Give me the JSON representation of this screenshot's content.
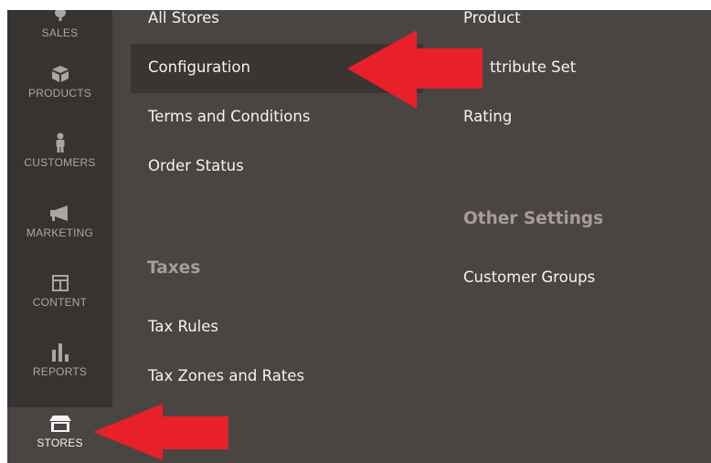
{
  "sidebar": {
    "items": [
      {
        "label": "SALES",
        "icon": "dollar-icon"
      },
      {
        "label": "PRODUCTS",
        "icon": "box-icon"
      },
      {
        "label": "CUSTOMERS",
        "icon": "person-icon"
      },
      {
        "label": "MARKETING",
        "icon": "megaphone-icon"
      },
      {
        "label": "CONTENT",
        "icon": "layout-icon"
      },
      {
        "label": "REPORTS",
        "icon": "bar-chart-icon"
      },
      {
        "label": "STORES",
        "icon": "storefront-icon",
        "active": true
      }
    ]
  },
  "submenu": {
    "settings_column": {
      "links": [
        "All Stores",
        "Configuration",
        "Terms and Conditions",
        "Order Status"
      ]
    },
    "taxes_section": {
      "heading": "Taxes",
      "links": [
        "Tax Rules",
        "Tax Zones and Rates"
      ]
    },
    "attributes_column": {
      "links": [
        "Product",
        "ttribute Set",
        "Rating"
      ]
    },
    "other_settings_section": {
      "heading": "Other Settings",
      "links": [
        "Customer Groups"
      ]
    }
  },
  "colors": {
    "menu_background": "#4a4542",
    "sidebar_background": "#373330",
    "highlight_row": "#3a3532",
    "annotation_arrow": "#e8202a"
  }
}
